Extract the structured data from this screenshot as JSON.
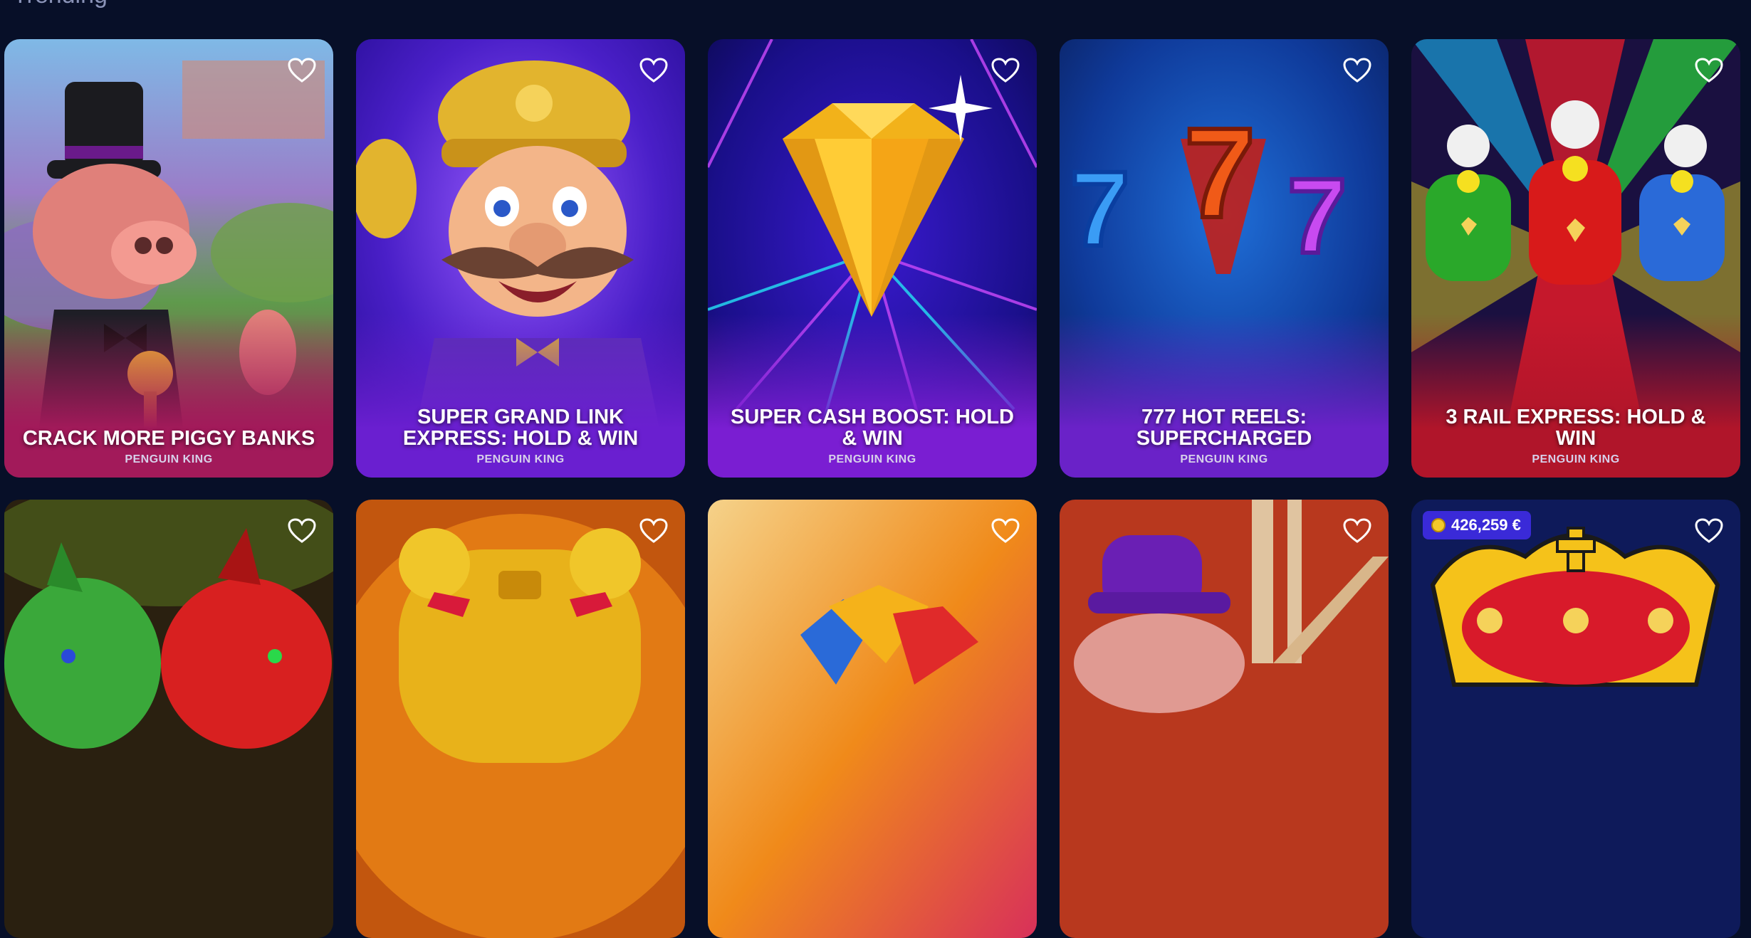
{
  "page": {
    "partial_heading": "Trending"
  },
  "games": [
    {
      "title": "CRACK MORE PIGGY BANKS",
      "provider": "PENGUIN KING",
      "icon": "heart-outline-icon",
      "footer_color": "#a21a5a"
    },
    {
      "title": "SUPER GRAND LINK EXPRESS: HOLD & WIN",
      "provider": "PENGUIN KING",
      "icon": "heart-outline-icon",
      "footer_color": "#6a1fd0"
    },
    {
      "title": "SUPER CASH BOOST: HOLD & WIN",
      "provider": "PENGUIN KING",
      "icon": "heart-outline-icon",
      "footer_color": "#7a1ed2"
    },
    {
      "title": "777 HOT REELS: SUPERCHARGED",
      "provider": "PENGUIN KING",
      "icon": "heart-outline-icon",
      "footer_color": "#6a22c8"
    },
    {
      "title": "3 RAIL EXPRESS: HOLD & WIN",
      "provider": "PENGUIN KING",
      "icon": "heart-outline-icon",
      "footer_color": "#b0152a"
    }
  ],
  "row2": {
    "jackpot": {
      "amount": "426,259 €",
      "icon": "coin-icon"
    }
  },
  "colors": {
    "background": "#070f28",
    "title_text": "#ffffff",
    "provider_text": "#d7d0ea",
    "jackpot_badge": "#3a2ad8"
  }
}
